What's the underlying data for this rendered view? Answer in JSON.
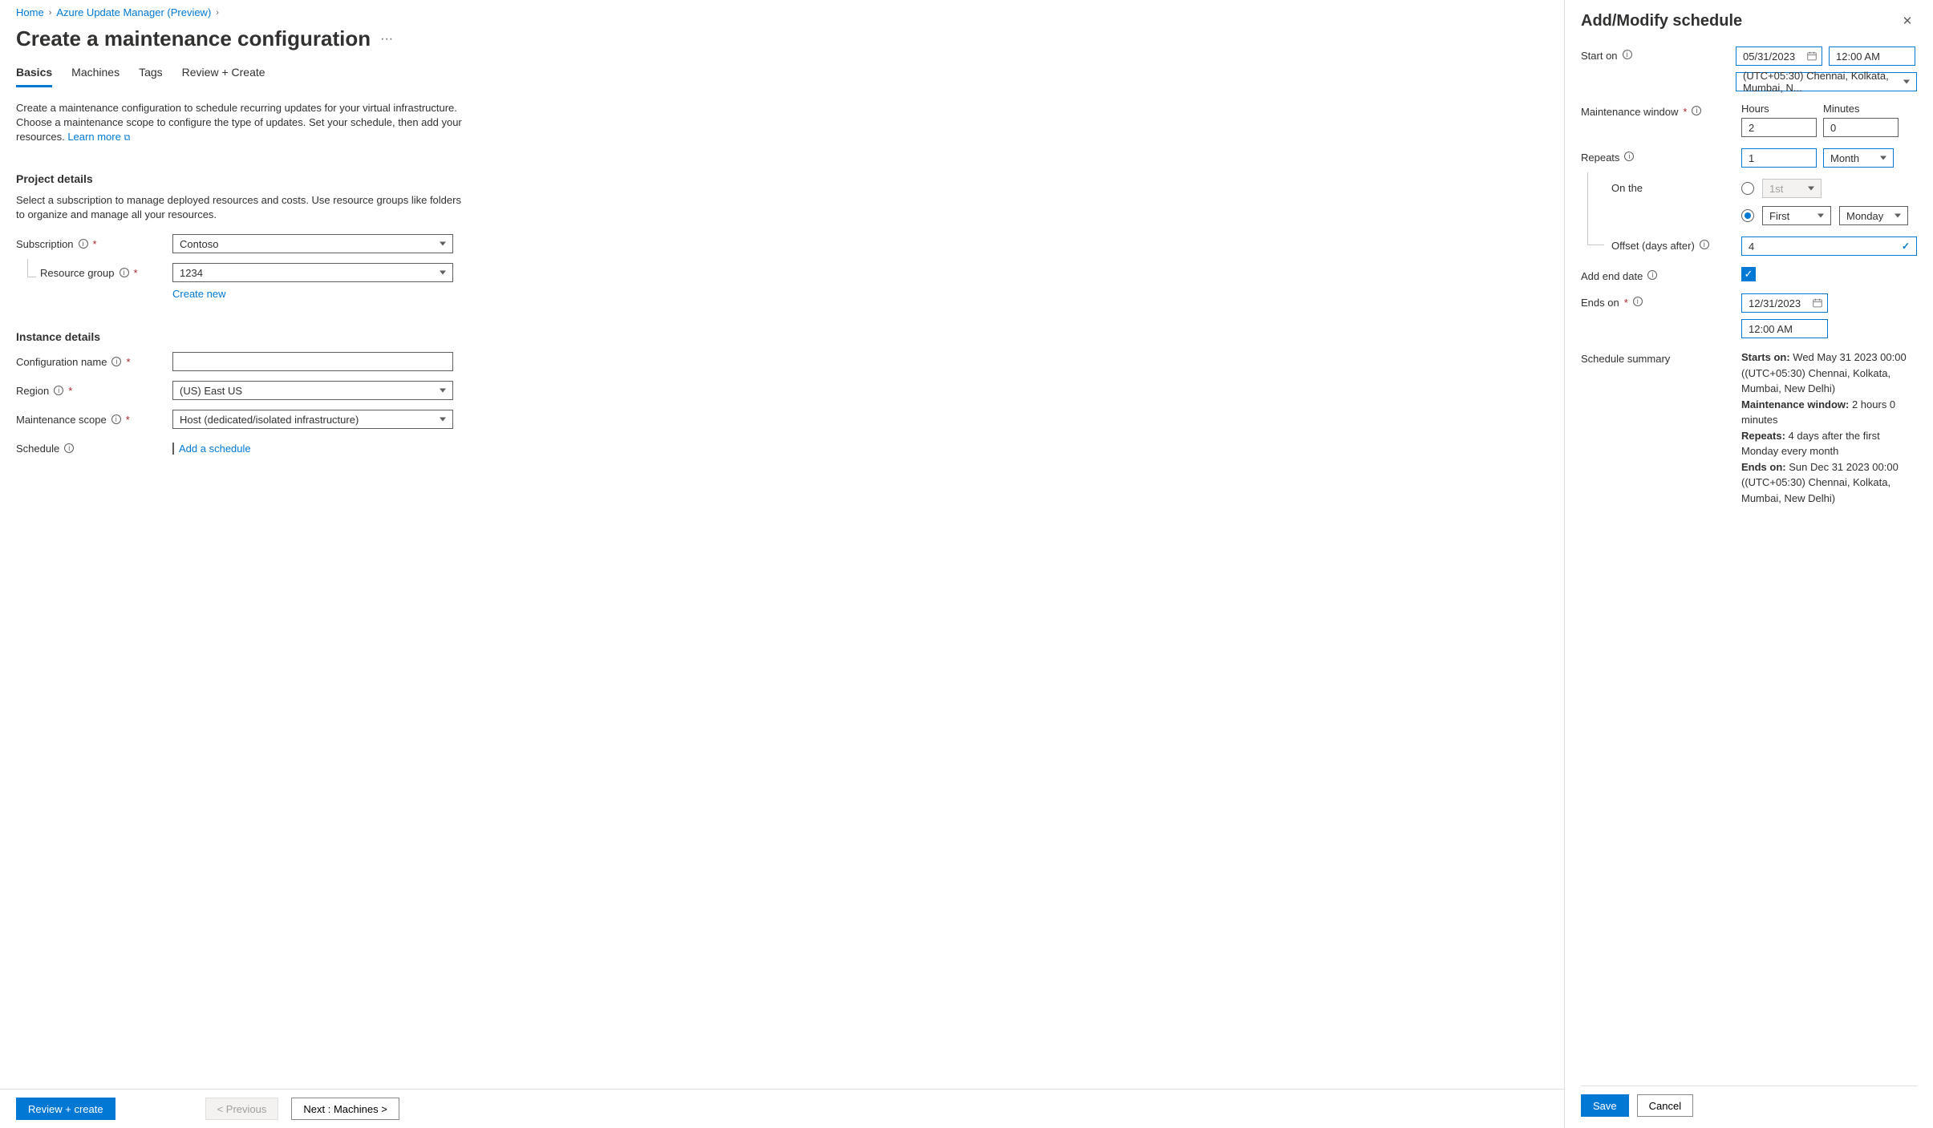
{
  "breadcrumb": {
    "home": "Home",
    "aum": "Azure Update Manager (Preview)"
  },
  "page": {
    "title": "Create a maintenance configuration"
  },
  "tabs": {
    "basics": "Basics",
    "machines": "Machines",
    "tags": "Tags",
    "review": "Review + Create"
  },
  "description": {
    "text": "Create a maintenance configuration to schedule recurring updates for your virtual infrastructure. Choose a maintenance scope to configure the type of updates. Set your schedule, then add your resources.",
    "learn_more": "Learn more"
  },
  "project": {
    "heading": "Project details",
    "note": "Select a subscription to manage deployed resources and costs. Use resource groups like folders to organize and manage all your resources.",
    "subscription_label": "Subscription",
    "subscription_value": "Contoso",
    "rg_label": "Resource group",
    "rg_value": "1234",
    "create_new": "Create new"
  },
  "instance": {
    "heading": "Instance details",
    "config_name_label": "Configuration name",
    "config_name_value": "",
    "region_label": "Region",
    "region_value": "(US) East US",
    "scope_label": "Maintenance scope",
    "scope_value": "Host (dedicated/isolated infrastructure)",
    "schedule_label": "Schedule",
    "add_schedule": "Add a schedule"
  },
  "footer": {
    "review": "Review + create",
    "previous": "< Previous",
    "next": "Next : Machines >"
  },
  "panel": {
    "title": "Add/Modify schedule",
    "start_on_label": "Start on",
    "start_on_date": "05/31/2023",
    "start_on_time": "12:00 AM",
    "tz": "(UTC+05:30) Chennai, Kolkata, Mumbai, N...",
    "mw_label": "Maintenance window",
    "hours_label": "Hours",
    "hours_value": "2",
    "minutes_label": "Minutes",
    "minutes_value": "0",
    "repeats_label": "Repeats",
    "repeats_value": "1",
    "repeats_unit": "Month",
    "on_the_label": "On the",
    "pattern1_value": "1st",
    "pattern2_ordinal": "First",
    "pattern2_day": "Monday",
    "offset_label": "Offset (days after)",
    "offset_value": "4",
    "add_end_label": "Add end date",
    "ends_on_label": "Ends on",
    "ends_on_date": "12/31/2023",
    "ends_on_time": "12:00 AM",
    "summary_label": "Schedule summary",
    "summary": {
      "starts_on_k": "Starts on:",
      "starts_on_v": " Wed May 31 2023 00:00 ((UTC+05:30) Chennai, Kolkata, Mumbai, New Delhi)",
      "mw_k": "Maintenance window:",
      "mw_v": " 2 hours 0 minutes",
      "repeats_k": "Repeats:",
      "repeats_v": " 4 days after the first Monday every month",
      "ends_on_k": "Ends on:",
      "ends_on_v": " Sun Dec 31 2023 00:00 ((UTC+05:30) Chennai, Kolkata, Mumbai, New Delhi)"
    },
    "save": "Save",
    "cancel": "Cancel"
  }
}
